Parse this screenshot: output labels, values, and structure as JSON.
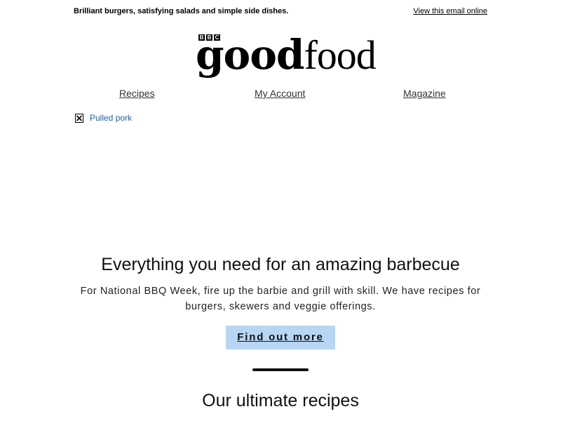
{
  "preheader": {
    "text": "Brilliant burgers, satisfying salads and simple side dishes.",
    "view_online": "View this email online"
  },
  "logo": {
    "bbc_letters": [
      "B",
      "B",
      "C"
    ],
    "word_good": "good",
    "word_food": "food"
  },
  "nav": {
    "items": [
      {
        "label": "Recipes"
      },
      {
        "label": "My Account"
      },
      {
        "label": "Magazine"
      }
    ]
  },
  "hero_image": {
    "alt": "Pulled pork",
    "icon": "broken-image-icon"
  },
  "feature": {
    "headline": "Everything you need for an amazing barbecue",
    "body": "For National BBQ Week, fire up the barbie and grill with skill. We have recipes for burgers, skewers and veggie offerings.",
    "cta_label": "Find out more"
  },
  "section": {
    "title": "Our ultimate recipes"
  },
  "colors": {
    "cta_background": "#b7d6f3",
    "alt_text": "#1a5fa8",
    "nav_link": "#333333"
  }
}
